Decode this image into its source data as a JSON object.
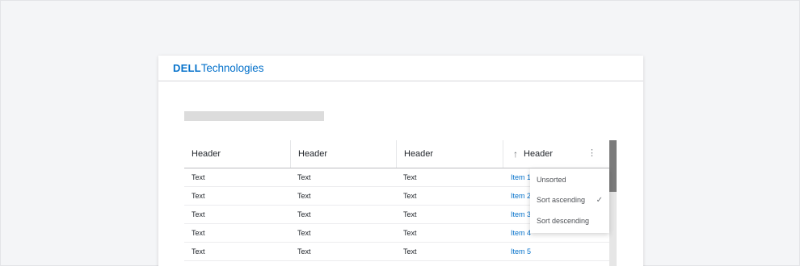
{
  "header": {
    "logo_mark": "DELL",
    "logo_text": "Technologies"
  },
  "table": {
    "columns": [
      "Header",
      "Header",
      "Header",
      "Header"
    ],
    "sort_icon": "arrow-up-icon",
    "menu_icon": "kebab-menu-icon",
    "rows": [
      [
        "Text",
        "Text",
        "Text",
        "Item 1"
      ],
      [
        "Text",
        "Text",
        "Text",
        "Item 2"
      ],
      [
        "Text",
        "Text",
        "Text",
        "Item 3"
      ],
      [
        "Text",
        "Text",
        "Text",
        "Item 4"
      ],
      [
        "Text",
        "Text",
        "Text",
        "Item 5"
      ]
    ]
  },
  "sort_menu": {
    "items": [
      "Unsorted",
      "Sort ascending",
      "Sort descending"
    ],
    "selected": "Sort ascending",
    "check_icon": "check-icon"
  },
  "colors": {
    "brand": "#0672cb",
    "page_bg": "#f4f5f7",
    "scroll_thumb": "#7b7b7b"
  }
}
